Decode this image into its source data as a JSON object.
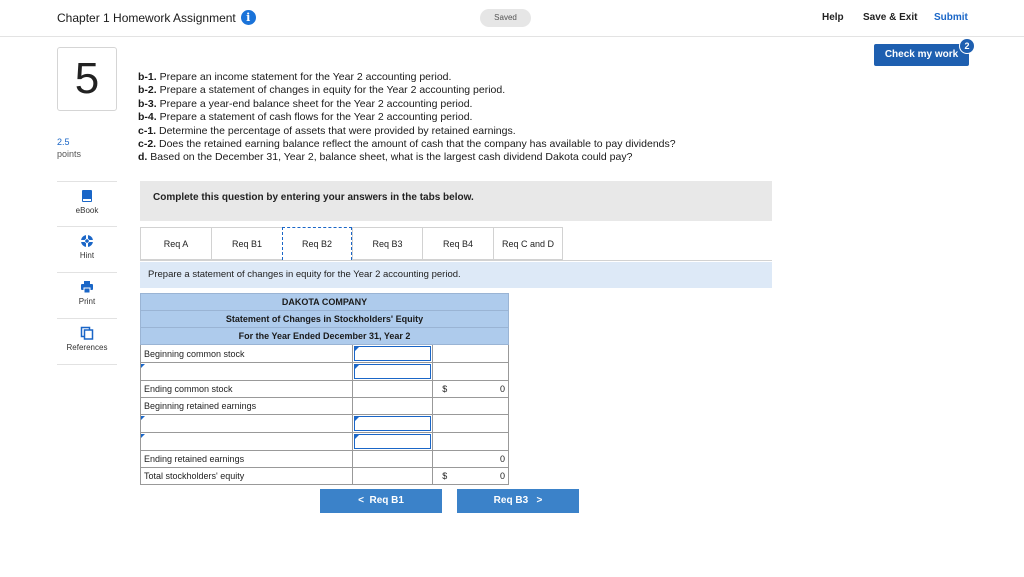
{
  "header": {
    "title": "Chapter 1 Homework Assignment",
    "info_icon": "i",
    "saved": "Saved",
    "help": "Help",
    "save_exit": "Save & Exit",
    "submit": "Submit",
    "check_my_work": "Check my work",
    "check_badge": "2"
  },
  "question": {
    "number": "5",
    "points_value": "2.5",
    "points_label": "points",
    "lines": [
      {
        "label": "b-1.",
        "text": " Prepare an income statement for the Year 2 accounting period."
      },
      {
        "label": "b-2.",
        "text": " Prepare a statement of changes in equity for the Year 2 accounting period."
      },
      {
        "label": "b-3.",
        "text": " Prepare a year-end balance sheet for the Year 2 accounting period."
      },
      {
        "label": "b-4.",
        "text": " Prepare a statement of cash flows for the Year 2 accounting period."
      },
      {
        "label": "c-1.",
        "text": " Determine the percentage of assets that were provided by retained earnings."
      },
      {
        "label": "c-2.",
        "text": " Does the retained earning balance reflect the amount of cash that the company has available to pay dividends?"
      },
      {
        "label": "d.",
        "text": " Based on the December 31, Year 2, balance sheet, what is the largest cash dividend Dakota could pay?"
      }
    ]
  },
  "sidebar": {
    "items": [
      {
        "label": "eBook",
        "icon": "book-icon"
      },
      {
        "label": "Hint",
        "icon": "lifebuoy-icon"
      },
      {
        "label": "Print",
        "icon": "printer-icon"
      },
      {
        "label": "References",
        "icon": "copy-icon"
      }
    ]
  },
  "instructions": "Complete this question by entering your answers in the tabs below.",
  "tabs": [
    {
      "label": "Req A",
      "width": 71
    },
    {
      "label": "Req B1",
      "width": 71
    },
    {
      "label": "Req B2",
      "width": 70,
      "active": true
    },
    {
      "label": "Req B3",
      "width": 70
    },
    {
      "label": "Req B4",
      "width": 71
    },
    {
      "label": "Req C and D",
      "width": 70
    }
  ],
  "prompt": "Prepare a statement of changes in equity for the Year 2 accounting period.",
  "statement": {
    "company": "DAKOTA COMPANY",
    "title": "Statement of Changes in Stockholders' Equity",
    "period": "For the Year Ended December 31, Year 2",
    "rows": [
      {
        "label": "Beginning common stock",
        "input": true,
        "total": ""
      },
      {
        "label": "",
        "label_input": true,
        "input": true,
        "total": ""
      },
      {
        "label": "Ending common stock",
        "input": false,
        "dollar": "$",
        "total": "0"
      },
      {
        "label": "Beginning retained earnings",
        "input": false,
        "total": ""
      },
      {
        "label": "",
        "label_input": true,
        "input": true,
        "total": ""
      },
      {
        "label": "",
        "label_input": true,
        "input": true,
        "total": ""
      },
      {
        "label": "Ending retained earnings",
        "input": false,
        "total": "0"
      },
      {
        "label": "Total stockholders' equity",
        "input": false,
        "dollar": "$",
        "total": "0"
      }
    ]
  },
  "nav": {
    "prev": "Req B1",
    "next": "Req B3"
  }
}
